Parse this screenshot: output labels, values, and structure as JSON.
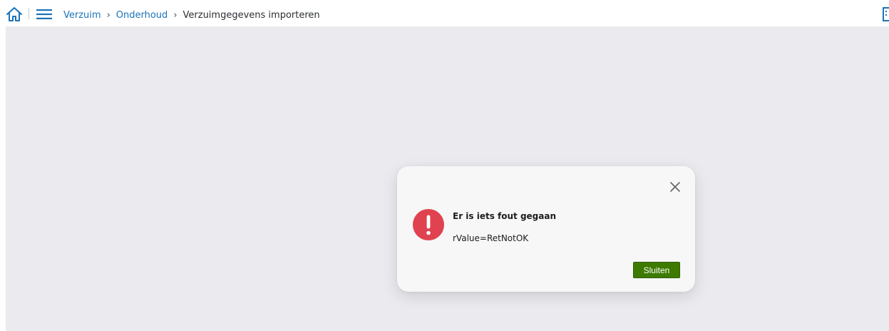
{
  "header": {
    "home_icon": "home-icon",
    "menu_icon": "hamburger-menu-icon",
    "right_icon": "building-icon",
    "link_color": "#1a73b8",
    "breadcrumb": {
      "items": [
        "Verzuim",
        "Onderhoud"
      ],
      "separator": "›",
      "current": "Verzuimgegevens importeren"
    }
  },
  "dialog": {
    "title": "Er is iets fout gegaan",
    "message": "rValue=RetNotOK",
    "close_icon": "close-icon",
    "error_icon": "exclamation-icon",
    "error_color": "#e0424f",
    "close_button_label": "Sluiten",
    "close_button_color": "#3d7a00"
  }
}
